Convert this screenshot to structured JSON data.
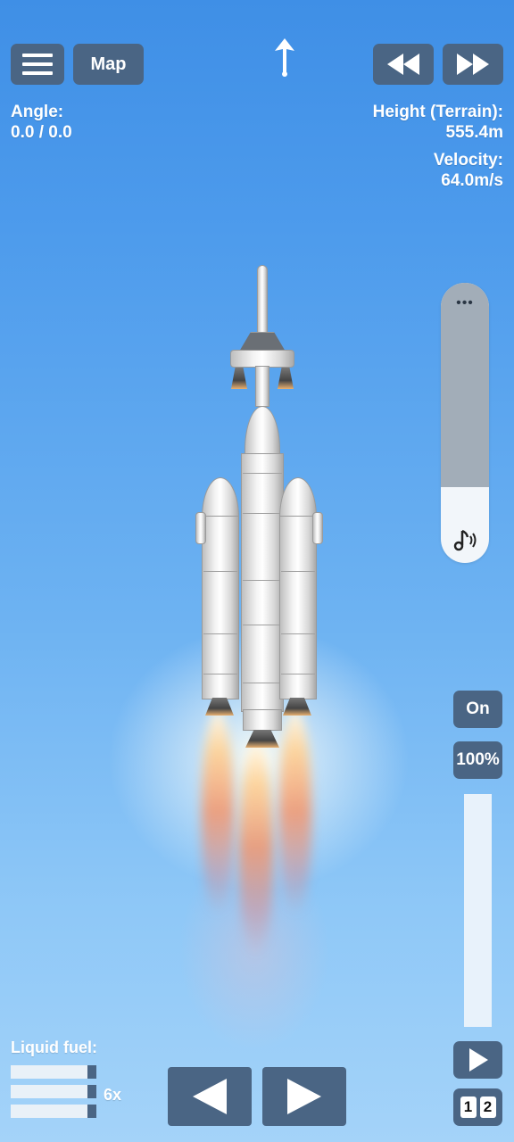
{
  "hud": {
    "map_label": "Map",
    "angle_label": "Angle:",
    "angle_value": "0.0 / 0.0",
    "height_label": "Height (Terrain):",
    "height_value": "555.4m",
    "velocity_label": "Velocity:",
    "velocity_value": "64.0m/s"
  },
  "throttle": {
    "on_label": "On",
    "percent_label": "100%",
    "level": 1.0
  },
  "sound_slider": {
    "dots": "•••",
    "level": 0.27
  },
  "fuel": {
    "label": "Liquid fuel:",
    "multiplier": "6x",
    "bars": [
      0.88,
      0.88,
      0.88
    ]
  },
  "stage": {
    "digit_1": "1",
    "digit_2": "2"
  },
  "icons": {
    "menu": "hamburger-menu-icon",
    "direction": "prograde-arrow-icon",
    "rewind": "rewind-icon",
    "fast_forward": "fast-forward-icon",
    "music": "music-note-icon",
    "play": "play-icon",
    "rotate_left": "rotate-left-icon",
    "rotate_right": "rotate-right-icon"
  },
  "colors": {
    "button": "#4a6584",
    "sky_top": "#3f8fe6",
    "sky_bottom": "#a4d3f9"
  }
}
